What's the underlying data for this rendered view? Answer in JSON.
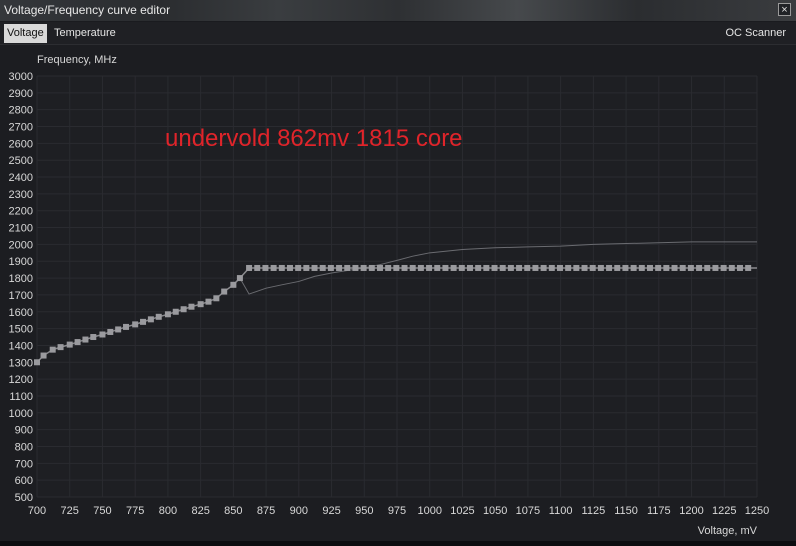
{
  "window": {
    "title": "Voltage/Frequency curve editor",
    "close_glyph": "×"
  },
  "tabs": [
    {
      "label": "Voltage",
      "active": true
    },
    {
      "label": "Temperature",
      "active": false
    }
  ],
  "oc_scanner_label": "OC Scanner",
  "annotation": {
    "text": "undervold 862mv 1815 core",
    "color": "#e0242a"
  },
  "colors": {
    "grid": "#2a2b30",
    "axis_text": "#d8d8d8",
    "curve": "#8a8a8e",
    "point": "#9a9a9e",
    "reference": "#6a6b70"
  },
  "chart_data": {
    "type": "line",
    "title": "",
    "xlabel": "Voltage, mV",
    "ylabel": "Frequency, MHz",
    "xlim": [
      700,
      1250
    ],
    "ylim": [
      500,
      3000
    ],
    "x_ticks": [
      700,
      725,
      750,
      775,
      800,
      825,
      850,
      875,
      900,
      925,
      950,
      975,
      1000,
      1025,
      1050,
      1075,
      1100,
      1125,
      1150,
      1175,
      1200,
      1225,
      1250
    ],
    "y_ticks": [
      500,
      600,
      700,
      800,
      900,
      1000,
      1100,
      1200,
      1300,
      1400,
      1500,
      1600,
      1700,
      1800,
      1900,
      2000,
      2100,
      2200,
      2300,
      2400,
      2500,
      2600,
      2700,
      2800,
      2900,
      3000
    ],
    "grid": true,
    "series": [
      {
        "role": "edited_curve",
        "markers": true,
        "x": [
          700,
          705,
          712,
          718,
          725,
          731,
          737,
          743,
          750,
          756,
          762,
          768,
          775,
          781,
          787,
          793,
          800,
          806,
          812,
          818,
          825,
          831,
          837,
          843,
          850,
          855,
          862,
          1250
        ],
        "y": [
          1300,
          1340,
          1375,
          1390,
          1405,
          1420,
          1435,
          1450,
          1465,
          1480,
          1495,
          1510,
          1525,
          1540,
          1555,
          1570,
          1585,
          1600,
          1615,
          1630,
          1645,
          1660,
          1680,
          1720,
          1760,
          1800,
          1860,
          1860
        ]
      },
      {
        "role": "reference_curve",
        "markers": false,
        "x": [
          855,
          862,
          875,
          887,
          900,
          912,
          925,
          937,
          950,
          962,
          975,
          987,
          1000,
          1025,
          1050,
          1075,
          1100,
          1125,
          1150,
          1175,
          1200,
          1225,
          1250
        ],
        "y": [
          1800,
          1705,
          1740,
          1760,
          1780,
          1810,
          1830,
          1845,
          1860,
          1880,
          1905,
          1930,
          1950,
          1970,
          1980,
          1985,
          1990,
          2000,
          2005,
          2010,
          2015,
          2015,
          2015
        ]
      }
    ]
  }
}
